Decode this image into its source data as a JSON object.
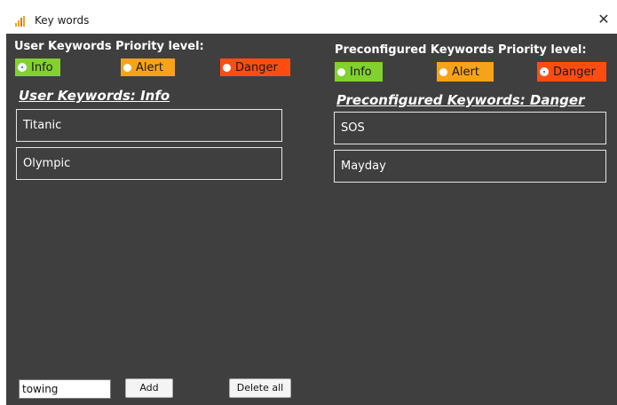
{
  "window": {
    "title": "Key words",
    "close_glyph": "✕"
  },
  "user": {
    "priority_label": "User Keywords Priority level:",
    "options": {
      "info": "Info",
      "alert": "Alert",
      "danger": "Danger"
    },
    "selected": "info",
    "heading": "User Keywords: Info",
    "keywords": [
      "Titanic",
      "Olympic"
    ]
  },
  "preconfigured": {
    "priority_label": "Preconfigured Keywords Priority level:",
    "options": {
      "info": "Info",
      "alert": "Alert",
      "danger": "Danger"
    },
    "selected": "danger",
    "heading": "Preconfigured Keywords: Danger",
    "keywords": [
      "SOS",
      "Mayday"
    ]
  },
  "footer": {
    "input_value": "towing",
    "add_label": "Add",
    "delete_all_label": "Delete all"
  },
  "colors": {
    "info": "#82d12e",
    "alert": "#f7a31a",
    "danger": "#ff4d12",
    "background": "#3f3f3f"
  },
  "icons": {
    "app": "bar-chart-icon",
    "close": "close-icon"
  }
}
